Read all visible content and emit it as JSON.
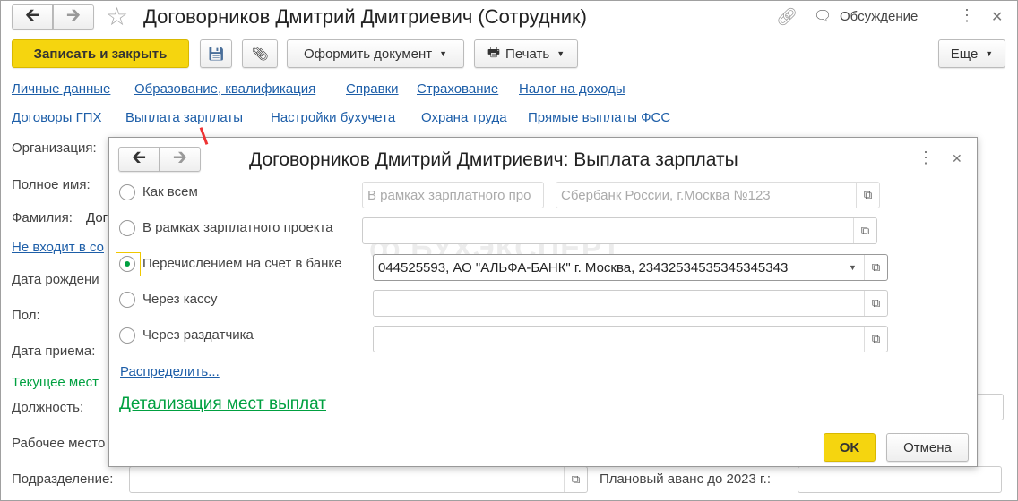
{
  "window": {
    "title": "Договорников Дмитрий Дмитриевич (Сотрудник)",
    "discussion": "Обсуждение"
  },
  "toolbar": {
    "save_close": "Записать и закрыть",
    "make_doc": "Оформить документ",
    "print": "Печать",
    "more": "Еще"
  },
  "links_row1": [
    "Личные данные",
    "Образование, квалификация",
    "Справки",
    "Страхование",
    "Налог на доходы"
  ],
  "links_row2": [
    "Договоры ГПХ",
    "Выплата зарплаты",
    "Настройки бухучета",
    "Охрана труда",
    "Прямые выплаты ФСС"
  ],
  "form": {
    "org": "Организация:",
    "fullname": "Полное имя:",
    "surname": "Фамилия:",
    "surname_val": "Дог",
    "not_in": "Не входит в со",
    "birth": "Дата рождени",
    "sex": "Пол:",
    "hire": "Дата приема:",
    "current": "Текущее мест",
    "position": "Должность:",
    "workplace": "Рабочее место",
    "dept": "Подразделение:",
    "advance": "Плановый аванс до 2023 г.:"
  },
  "dialog": {
    "title": "Договорников Дмитрий Дмитриевич: Выплата зарплаты",
    "options": [
      {
        "label": "Как всем",
        "selected": false
      },
      {
        "label": "В рамках зарплатного проекта",
        "selected": false
      },
      {
        "label": "Перечислением на счет в банке",
        "selected": true
      },
      {
        "label": "Через кассу",
        "selected": false
      },
      {
        "label": "Через раздатчика",
        "selected": false
      }
    ],
    "kak_vsem_field1": "В рамках зарплатного про",
    "kak_vsem_field2": "Сбербанк России, г.Москва №123",
    "bank_value": "044525593, АО \"АЛЬФА-БАНК\" г. Москва, 23432534535345345343",
    "distribute": "Распределить...",
    "detail": "Детализация мест выплат",
    "ok": "OK",
    "cancel": "Отмена",
    "watermark": "БУХЭКСПЕРТ"
  },
  "colors": {
    "accent": "#f5d50f",
    "link": "#1d5ea8",
    "green": "#00a040"
  }
}
